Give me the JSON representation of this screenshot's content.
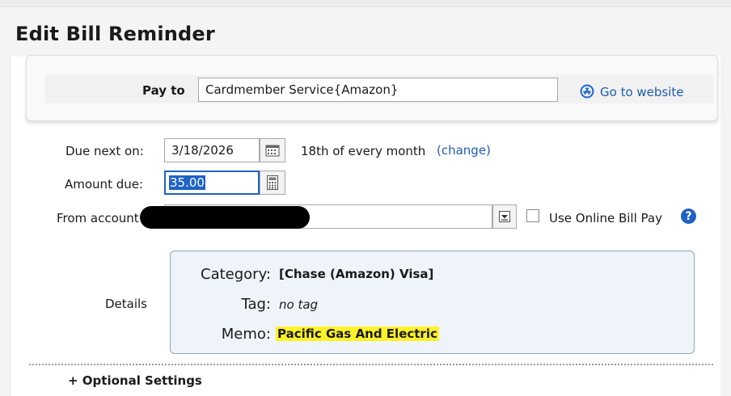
{
  "page": {
    "title": "Edit Bill Reminder"
  },
  "pay_to": {
    "label": "Pay to",
    "value": "Cardmember Service{Amazon}",
    "website_link": "Go to website",
    "website_icon": "globe-link-icon"
  },
  "due_next_on": {
    "label": "Due next on:",
    "value": "3/18/2026",
    "calendar_icon": "calendar-icon",
    "frequency": "18th of every month",
    "change_link": "(change)"
  },
  "amount_due": {
    "label": "Amount due:",
    "value": "35.00",
    "calculator_icon": "calculator-icon"
  },
  "from_account": {
    "label": "From account",
    "value": "",
    "dropdown_icon": "dropdown-icon",
    "online_bill_pay_label": "Use Online Bill Pay",
    "online_bill_pay_checked": false,
    "help_icon": "help-icon",
    "help_symbol": "?"
  },
  "details": {
    "label": "Details",
    "category_label": "Category:",
    "category_value": "[Chase (Amazon) Visa]",
    "tag_label": "Tag:",
    "tag_value": "no tag",
    "memo_label": "Memo:",
    "memo_value": "Pacific Gas And Electric",
    "memo_highlight_color": "#fff229"
  },
  "colors": {
    "link": "#1f5bb5",
    "selection": "#1e63c7",
    "details_bg": "#eef4fa"
  },
  "bottom": {
    "partial_text": "+ Optional Settings"
  }
}
